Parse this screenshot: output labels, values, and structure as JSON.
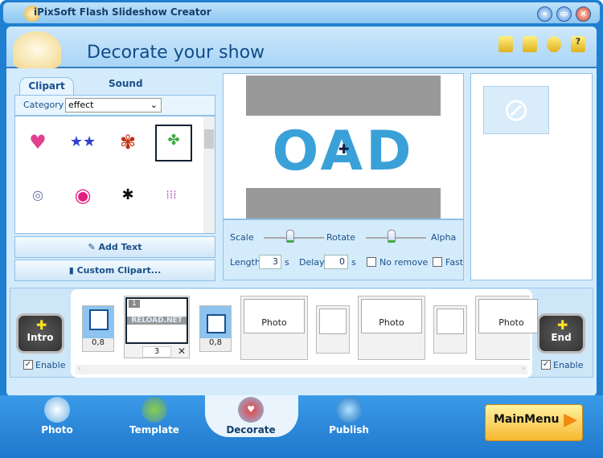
{
  "window": {
    "title": "iPixSoft Flash Slideshow Creator"
  },
  "header": {
    "title": "Decorate your show",
    "icons": [
      "folder-icon",
      "save-icon",
      "user-icon",
      "help-icon"
    ]
  },
  "clipart": {
    "tabs": [
      "Clipart",
      "Sound"
    ],
    "category_label": "Category",
    "category_value": "effect",
    "items": [
      "heart",
      "stars",
      "butterfly",
      "confetti",
      "ring",
      "lips",
      "ant",
      "drops"
    ],
    "add_text": "Add Text",
    "custom_clipart": "Custom Clipart..."
  },
  "preview": {
    "text": "OAD"
  },
  "controls": {
    "scale": "Scale",
    "rotate": "Rotate",
    "alpha": "Alpha",
    "length_label": "Length",
    "length_value": "3",
    "delay_label": "Delay",
    "delay_value": "0",
    "unit": "s",
    "no_remove": "No remove",
    "fast": "Fast"
  },
  "timeline": {
    "intro": "Intro",
    "end": "End",
    "enable": "Enable",
    "transition1": "0,8",
    "transition2": "0,8",
    "slide_number": "1",
    "slide_caption": "RELOAD.NET",
    "slide_duration": "3",
    "placeholders": [
      "Photo",
      "Photo",
      "Photo"
    ]
  },
  "nav": {
    "items": [
      "Photo",
      "Template",
      "Decorate",
      "Publish"
    ],
    "main_menu": "MainMenu"
  }
}
